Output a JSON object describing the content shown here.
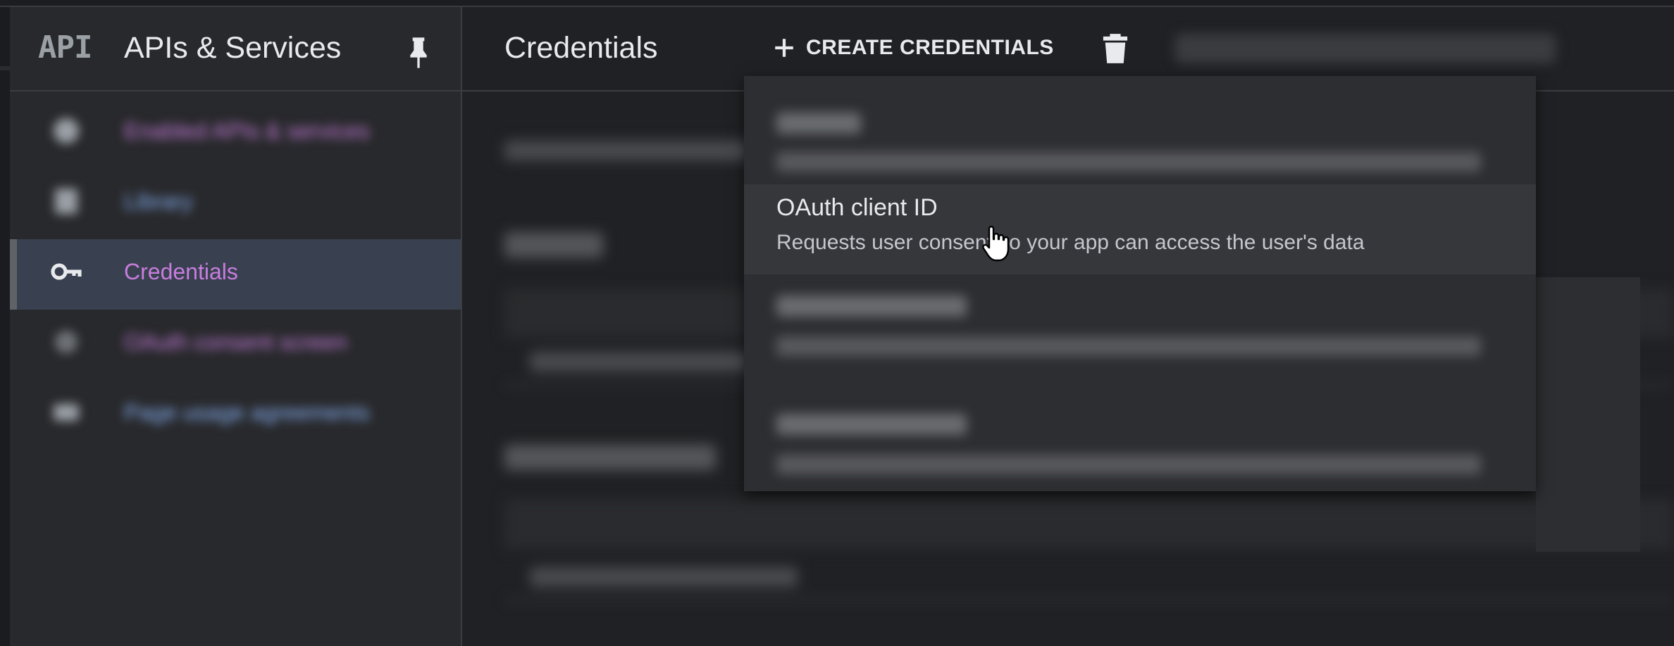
{
  "sidebar": {
    "logo_text": "API",
    "title": "APIs & Services",
    "items": [
      {
        "label": "Enabled APIs & services",
        "icon": "grid-icon",
        "color": "#c77dde"
      },
      {
        "label": "Library",
        "icon": "library-icon",
        "color": "#8ab4f8"
      },
      {
        "label": "Credentials",
        "icon": "key-icon",
        "color": "#c77dde"
      },
      {
        "label": "OAuth consent screen",
        "icon": "consent-icon",
        "color": "#c77dde"
      },
      {
        "label": "Page usage agreements",
        "icon": "agreements-icon",
        "color": "#8ab4f8"
      }
    ]
  },
  "header": {
    "title": "Credentials",
    "create_label": "CREATE CREDENTIALS",
    "delete_icon": "trash-icon"
  },
  "menu": {
    "items": [
      {
        "title": "API key",
        "desc": "Identifies your project using a simple API key to check quota and access"
      },
      {
        "title": "OAuth client ID",
        "desc": "Requests user consent so your app can access the user's data"
      },
      {
        "title": "Service account",
        "desc": "Enables server-to-server, app-level authentication using robot accounts"
      },
      {
        "title": "Help me choose",
        "desc": "Asks a few questions to help you decide which type of credential to use"
      }
    ]
  },
  "colors": {
    "accent_purple": "#c77dde",
    "accent_blue": "#8ab4f8",
    "active_bg": "#394150"
  }
}
